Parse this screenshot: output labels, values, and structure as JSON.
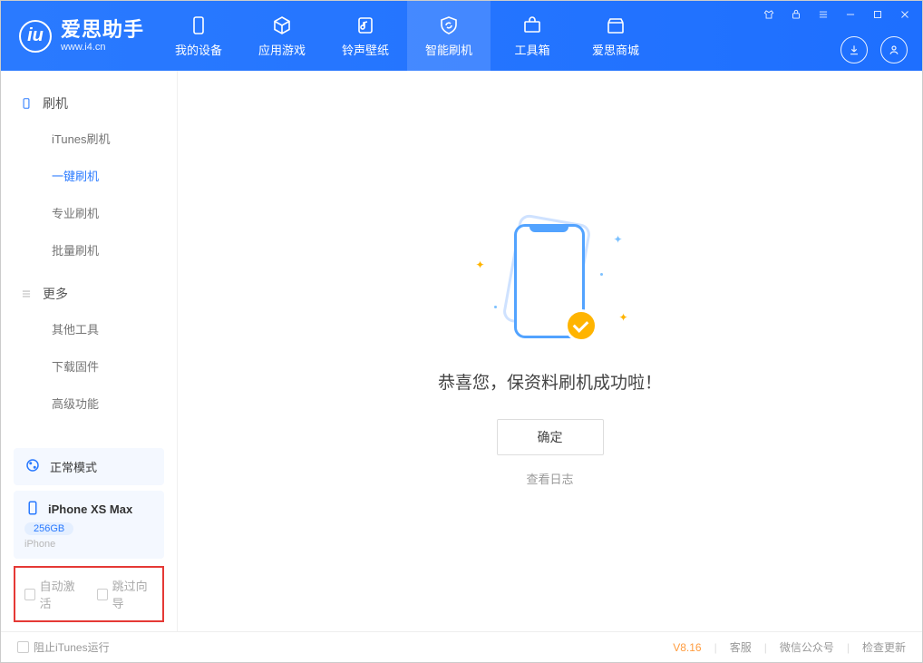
{
  "app": {
    "name": "爱思助手",
    "url": "www.i4.cn"
  },
  "topTabs": {
    "device": "我的设备",
    "apps": "应用游戏",
    "ring": "铃声壁纸",
    "flash": "智能刷机",
    "tools": "工具箱",
    "store": "爱思商城"
  },
  "sidebar": {
    "group1": {
      "title": "刷机",
      "items": {
        "itunes": "iTunes刷机",
        "oneclick": "一键刷机",
        "pro": "专业刷机",
        "batch": "批量刷机"
      }
    },
    "group2": {
      "title": "更多",
      "items": {
        "other": "其他工具",
        "firmware": "下载固件",
        "advanced": "高级功能"
      }
    },
    "mode": "正常模式",
    "device": {
      "name": "iPhone XS Max",
      "capacity": "256GB",
      "type": "iPhone"
    },
    "checks": {
      "autoActivate": "自动激活",
      "skipGuide": "跳过向导"
    }
  },
  "main": {
    "success": "恭喜您，保资料刷机成功啦！",
    "ok": "确定",
    "viewLog": "查看日志"
  },
  "footer": {
    "blockItunes": "阻止iTunes运行",
    "version": "V8.16",
    "support": "客服",
    "wechat": "微信公众号",
    "update": "检查更新"
  }
}
